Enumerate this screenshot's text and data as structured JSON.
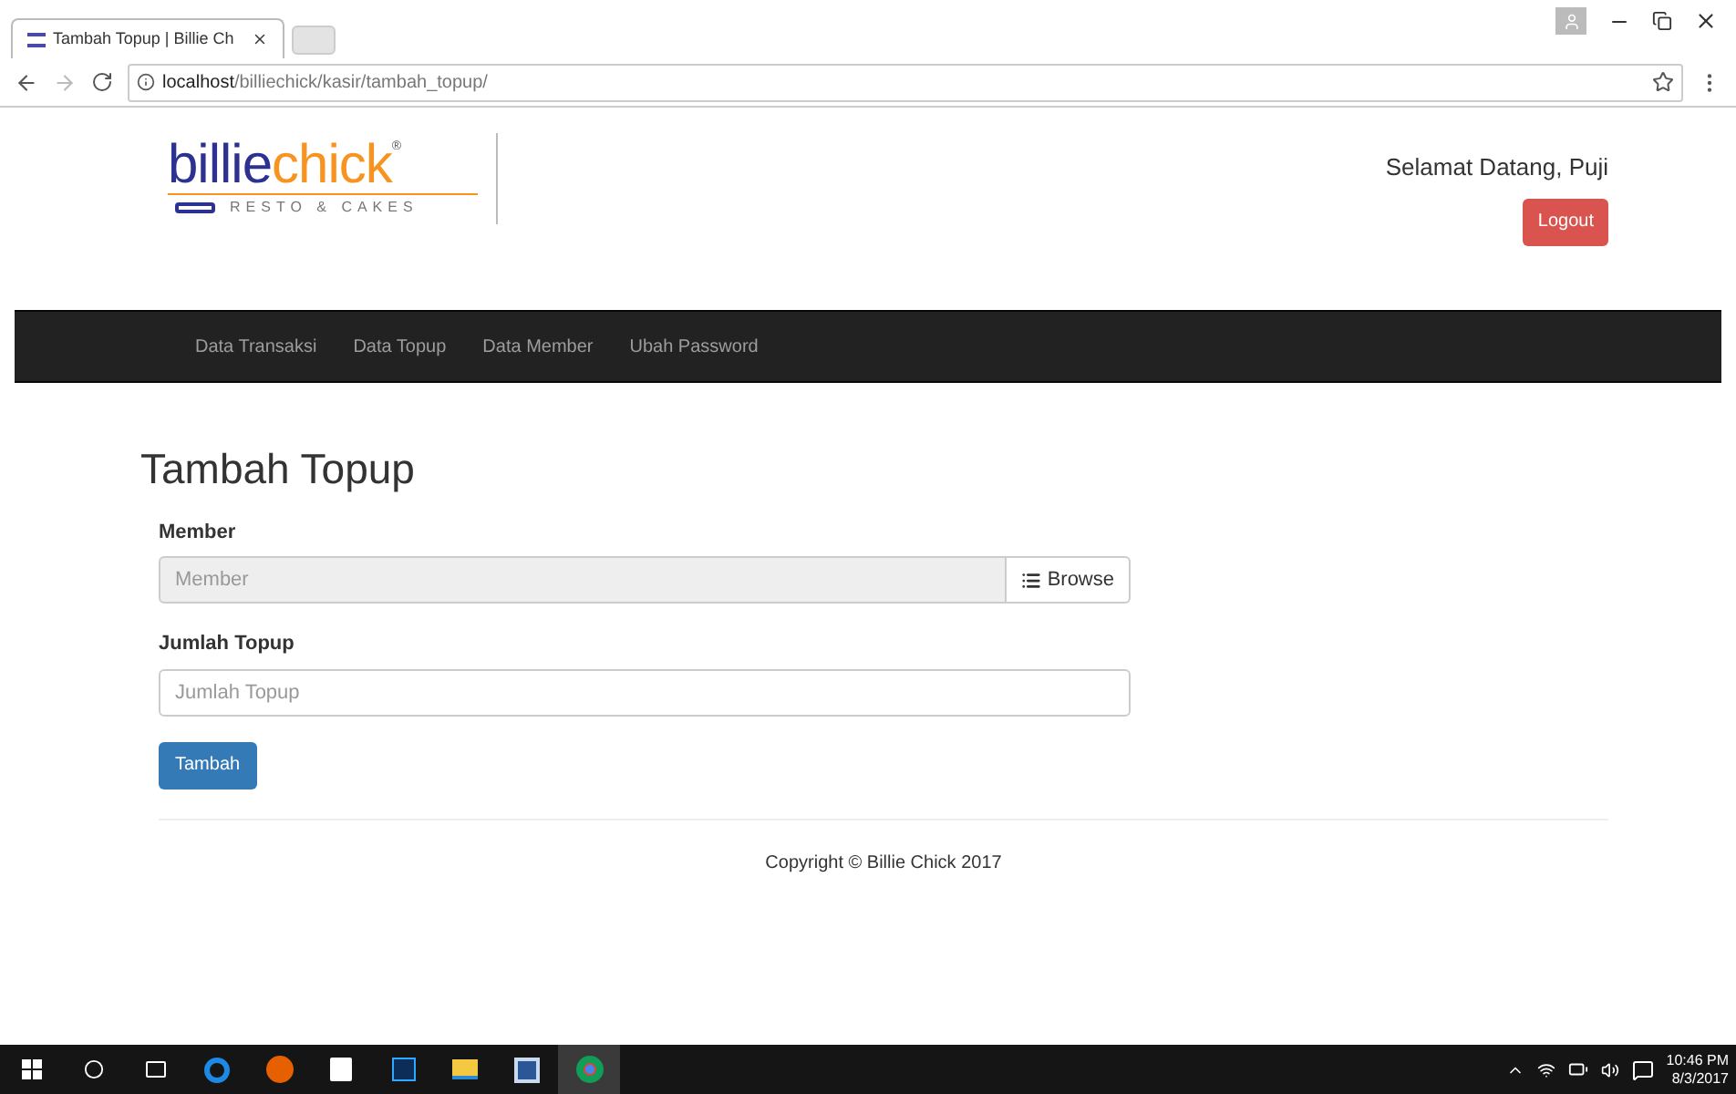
{
  "browser": {
    "tab_title": "Tambah Topup | Billie Ch",
    "url_host": "localhost",
    "url_path": "/billiechick/kasir/tambah_topup/"
  },
  "header": {
    "logo": {
      "part_1": "billie",
      "part_2": "chick",
      "mark": "®",
      "tagline": "RESTO & CAKES"
    },
    "welcome": "Selamat Datang, Puji",
    "logout": "Logout"
  },
  "nav": {
    "items": [
      {
        "label": "Data Transaksi"
      },
      {
        "label": "Data Topup"
      },
      {
        "label": "Data Member"
      },
      {
        "label": "Ubah Password"
      }
    ]
  },
  "form": {
    "title": "Tambah Topup",
    "fields": [
      {
        "kind": "browse",
        "label": "Member",
        "placeholder": "Member",
        "disabled": true,
        "button": "Browse"
      },
      {
        "kind": "text",
        "label": "Jumlah Topup",
        "placeholder": "Jumlah Topup",
        "disabled": false
      }
    ],
    "submit": "Tambah"
  },
  "footer": "Copyright © Billie Chick 2017",
  "taskbar": {
    "time": "10:46 PM",
    "date": "8/3/2017"
  }
}
